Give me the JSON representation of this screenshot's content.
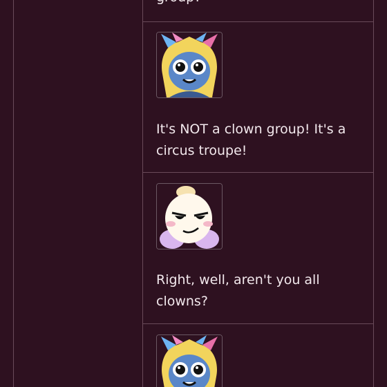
{
  "messages": [
    {
      "text": "group?"
    },
    {
      "avatar": "blue-fairy-avatar-icon",
      "text": "It's NOT a clown group! It's a circus troupe!"
    },
    {
      "avatar": "white-fairy-avatar-icon",
      "text": "Right, well, aren't you all clowns?"
    },
    {
      "avatar": "blue-fairy-avatar-icon",
      "text": ""
    }
  ],
  "colors": {
    "background": "#2e1120",
    "divider": "#6a4b5a",
    "text": "#f2e8ec"
  }
}
